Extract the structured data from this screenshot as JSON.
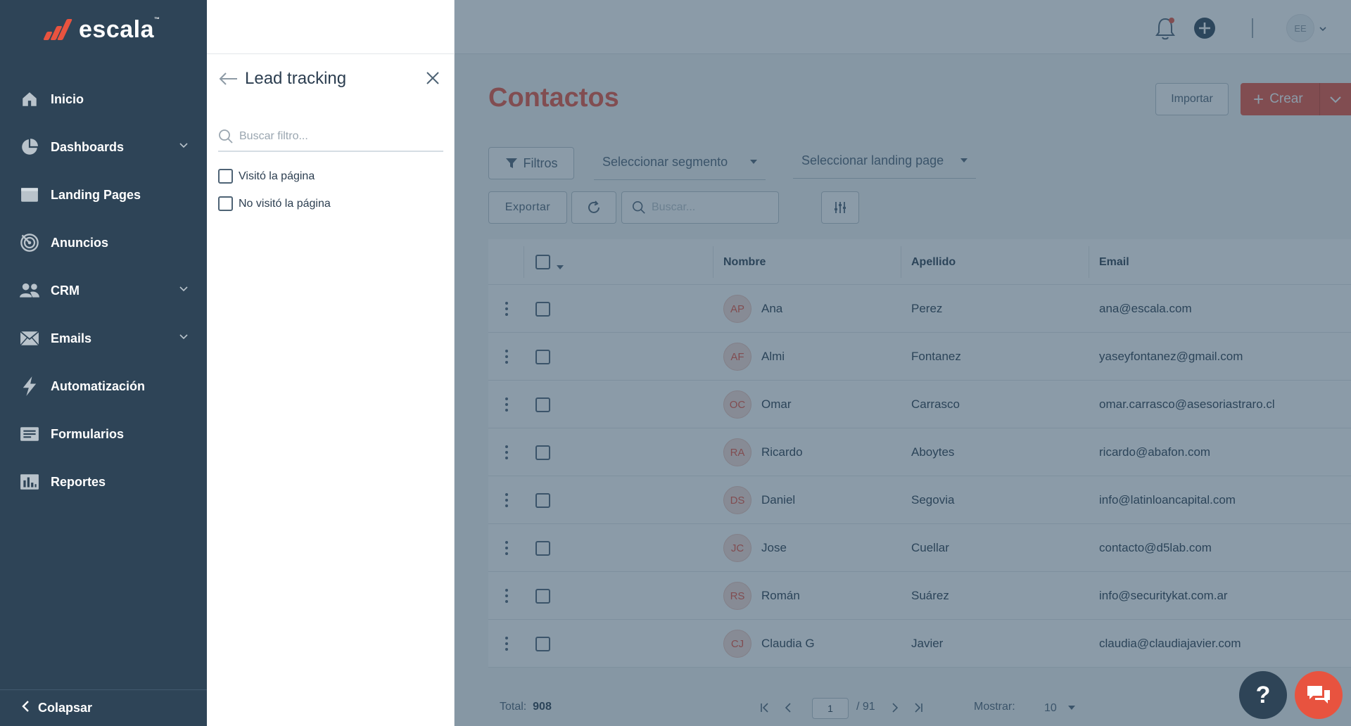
{
  "brand": {
    "name": "escala",
    "tm": "™",
    "accent": "#e8533f",
    "sidebar_bg": "#2e4457"
  },
  "sidebar": {
    "items": [
      {
        "label": "Inicio",
        "icon": "home-icon",
        "expandable": false
      },
      {
        "label": "Dashboards",
        "icon": "pie-chart-icon",
        "expandable": true
      },
      {
        "label": "Landing Pages",
        "icon": "browser-window-icon",
        "expandable": false
      },
      {
        "label": "Anuncios",
        "icon": "target-icon",
        "expandable": false
      },
      {
        "label": "CRM",
        "icon": "users-icon",
        "expandable": true
      },
      {
        "label": "Emails",
        "icon": "envelope-icon",
        "expandable": true
      },
      {
        "label": "Automatización",
        "icon": "lightning-icon",
        "expandable": false
      },
      {
        "label": "Formularios",
        "icon": "form-icon",
        "expandable": false
      },
      {
        "label": "Reportes",
        "icon": "bar-chart-icon",
        "expandable": false
      }
    ],
    "collapse_label": "Colapsar"
  },
  "filter_panel": {
    "title": "Lead tracking",
    "search_placeholder": "Buscar filtro...",
    "options": [
      "Visitó la página",
      "No visitó la página"
    ]
  },
  "topbar": {
    "avatar_initials": "EE"
  },
  "main": {
    "title": "Contactos",
    "import_label": "Importar",
    "create_label": "Crear",
    "filters_label": "Filtros",
    "segment_placeholder": "Seleccionar segmento",
    "landing_placeholder": "Seleccionar landing page",
    "export_label": "Exportar",
    "search_placeholder": "Buscar..."
  },
  "table": {
    "columns": [
      "Nombre",
      "Apellido",
      "Email"
    ],
    "rows": [
      {
        "initials": "AP",
        "nombre": "Ana",
        "apellido": "Perez",
        "email": "ana@escala.com"
      },
      {
        "initials": "AF",
        "nombre": "Almi",
        "apellido": "Fontanez",
        "email": "yaseyfontanez@gmail.com"
      },
      {
        "initials": "OC",
        "nombre": "Omar",
        "apellido": "Carrasco",
        "email": "omar.carrasco@asesoriastraro.cl"
      },
      {
        "initials": "RA",
        "nombre": "Ricardo",
        "apellido": "Aboytes",
        "email": "ricardo@abafon.com"
      },
      {
        "initials": "DS",
        "nombre": "Daniel",
        "apellido": "Segovia",
        "email": "info@latinloancapital.com"
      },
      {
        "initials": "JC",
        "nombre": "Jose",
        "apellido": "Cuellar",
        "email": "contacto@d5lab.com"
      },
      {
        "initials": "RS",
        "nombre": "Román",
        "apellido": "Suárez",
        "email": "info@securitykat.com.ar"
      },
      {
        "initials": "CJ",
        "nombre": "Claudia G",
        "apellido": "Javier",
        "email": "claudia@claudiajavier.com"
      }
    ]
  },
  "footer": {
    "total_label": "Total:",
    "total_value": "908",
    "page_current": "1",
    "page_total": "/ 91",
    "show_label": "Mostrar:",
    "show_value": "10"
  },
  "help_label": "?"
}
